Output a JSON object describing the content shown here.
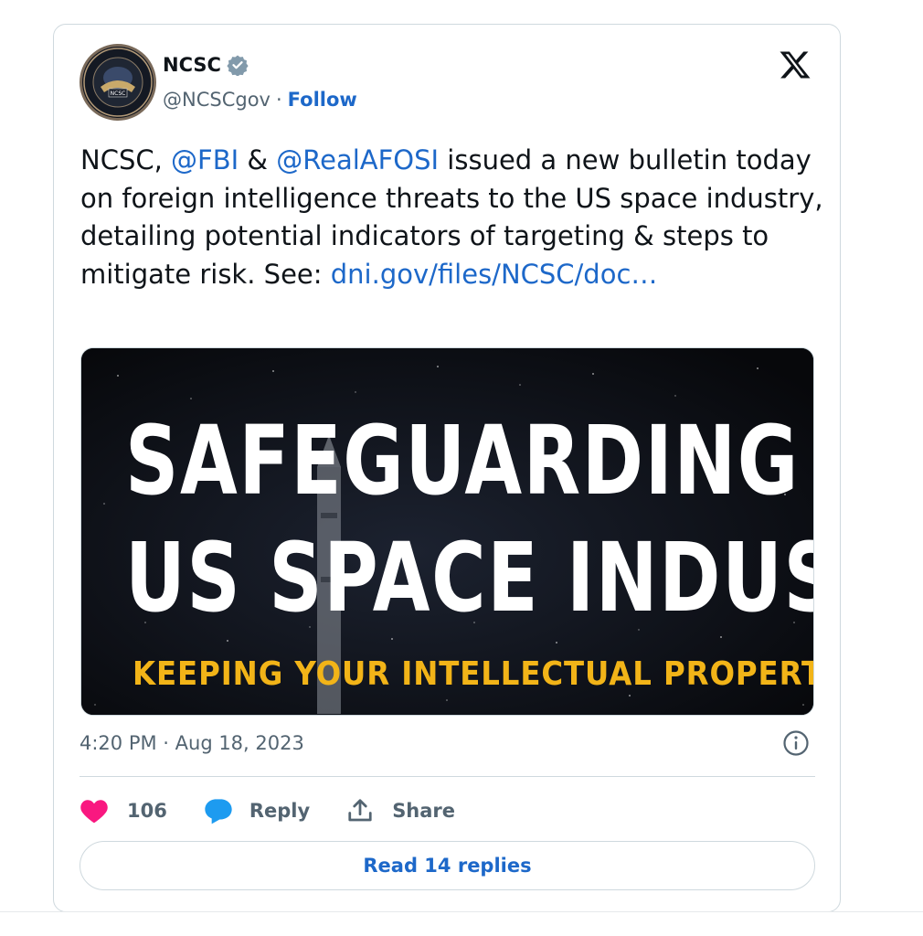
{
  "author": {
    "name": "NCSC",
    "handle": "@NCSCgov",
    "separator": "·",
    "follow_label": "Follow",
    "verified": true,
    "avatar_icon": "ncsc-seal"
  },
  "tweet": {
    "text_part1": "NCSC, ",
    "mention1": "@FBI",
    "text_part2": " & ",
    "mention2": "@RealAFOSI",
    "text_part3": " issued a new bulletin today on foreign intelligence threats to the US space industry, detailing potential indicators of targeting & steps to mitigate risk. See: ",
    "link": "dni.gov/files/NCSC/doc…",
    "timestamp": "4:20 PM · Aug 18, 2023"
  },
  "media": {
    "line1": "SAFEGUARDING T",
    "line2": "US SPACE INDUST",
    "line3": "KEEPING YOUR INTELLECTUAL PROPERT"
  },
  "actions": {
    "likes": "106",
    "reply_label": "Reply",
    "share_label": "Share",
    "read_replies": "Read 14 replies"
  },
  "colors": {
    "link": "#1d68c9",
    "heart": "#f91880",
    "reply_icon": "#1d9bf0",
    "accent_yellow": "#f2b418"
  }
}
